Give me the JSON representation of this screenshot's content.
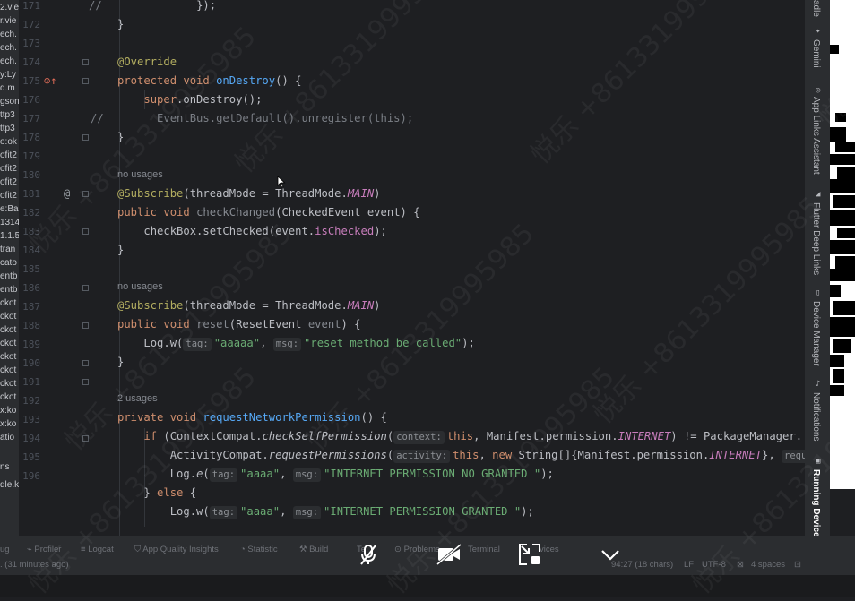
{
  "left_panel": {
    "fragments": [
      "2.vie",
      "r.vie",
      "ech.",
      "ech.",
      "ech.",
      "y:Ly",
      "d.m",
      "gson",
      "ttp3",
      "ttp3",
      "o:ok",
      "ofit2",
      "ofit2",
      "ofit2",
      "ofit2",
      "e:Bas",
      "1314",
      "1.1.5",
      "tran",
      "cato",
      "entb",
      "entb",
      "ckot",
      "ckot",
      "ckot",
      "ckot",
      "ckot",
      "ckot",
      "ckot",
      "ckot",
      "x:ko",
      "x:ko",
      "atio",
      "ns",
      "dle.k"
    ]
  },
  "editor": {
    "line_numbers": [
      "171",
      "172",
      "173",
      "174",
      "175",
      "176",
      "177",
      "178",
      "179",
      "180",
      "181",
      "182",
      "183",
      "184",
      "185",
      "186",
      "187",
      "188",
      "189",
      "190",
      "191",
      "192",
      "193",
      "194",
      "195",
      "196"
    ],
    "usages": {
      "u180": "no usages",
      "u185": "no usages",
      "u190": "2 usages"
    },
    "tokens": {
      "l171a": "//",
      "l171b": "});",
      "l172": "}",
      "l174": "@Override",
      "l175a": "protected void ",
      "l175b": "onDestroy",
      "l175c": "() {",
      "l176a": "super",
      "l176b": ".onDestroy();",
      "l177a": "//",
      "l177b": "EventBus.getDefault().unregister(this);",
      "l178": "}",
      "l180a": "@Subscribe",
      "l180b": "(threadMode = ThreadMode.",
      "l180c": "MAIN",
      "l180d": ")",
      "l181a": "public void ",
      "l181b": "checkChanged",
      "l181c": "(CheckedEvent event) {",
      "l182a": "checkBox.setChecked(event.",
      "l182b": "isChecked",
      "l182c": ");",
      "l183": "}",
      "l185a": "@Subscribe",
      "l185b": "(threadMode = ThreadMode.",
      "l185c": "MAIN",
      "l185d": ")",
      "l186a": "public void ",
      "l186b": "reset",
      "l186c": "(ResetEvent ",
      "l186d": "event",
      "l186e": ") {",
      "l187a": "Log.w(",
      "l187h1": "tag:",
      "l187b": "\"aaaaa\"",
      "l187c": ", ",
      "l187h2": "msg:",
      "l187d": "\"reset method be called\"",
      "l187e": ");",
      "l188": "}",
      "l190a": "private void ",
      "l190b": "requestNetworkPermission",
      "l190c": "() {",
      "l191a": "if ",
      "l191b": "(ContextCompat.",
      "l191c": "checkSelfPermission",
      "l191d": "(",
      "l191h": "context:",
      "l191e": "this",
      "l191f": ", Manifest.permission.",
      "l191g": "INTERNET",
      "l191i": ") != PackageManager.",
      "l192a": "ActivityCompat.",
      "l192b": "requestPermissions",
      "l192c": "(",
      "l192h": "activity:",
      "l192d": "this",
      "l192e": ", ",
      "l192f": "new ",
      "l192g": "String[]{Manifest.permission.",
      "l192i": "INTERNET",
      "l192j": "}, ",
      "l192k": "reques",
      "l193a": "Log.",
      "l193b": "e",
      "l193c": "(",
      "l193h1": "tag:",
      "l193d": "\"aaaa\"",
      "l193e": ", ",
      "l193h2": "msg:",
      "l193f": "\"INTERNET PERMISSION NO GRANTED \"",
      "l193g": ");",
      "l194a": "} ",
      "l194b": "else",
      "l194c": " {",
      "l195a": "Log.w(",
      "l195h1": "tag:",
      "l195b": "\"aaaa\"",
      "l195c": ", ",
      "l195h2": "msg:",
      "l195d": "\"INTERNET PERMISSION GRANTED \"",
      "l195e": ");"
    }
  },
  "right_toolbar": {
    "tabs": [
      "Gemini",
      "App Links Assistant",
      "Flutter Deep Links",
      "Device Manager",
      "Notifications",
      "Running Devices"
    ],
    "top_label": "adle"
  },
  "status_bar": {
    "tabs": [
      "ug",
      "Profiler",
      "Logcat",
      "App Quality Insights",
      "Statistic",
      "Build",
      "Te",
      "Problems",
      "Terminal",
      "vices"
    ],
    "left_info": ". (31 minutes ago)",
    "position": "94:27 (18 chars)",
    "line_sep": "LF",
    "encoding": "UTF-8",
    "indent": "4 spaces"
  },
  "watermark": {
    "text": "悦乐 +8613319995985"
  },
  "colors": {
    "editor_bg": "#1e1f22",
    "panel_bg": "#2b2d30",
    "keyword": "#cf8e6d",
    "function": "#56a8f5",
    "string": "#6aab73",
    "annotation": "#b3ae60",
    "field": "#c77dbb"
  }
}
